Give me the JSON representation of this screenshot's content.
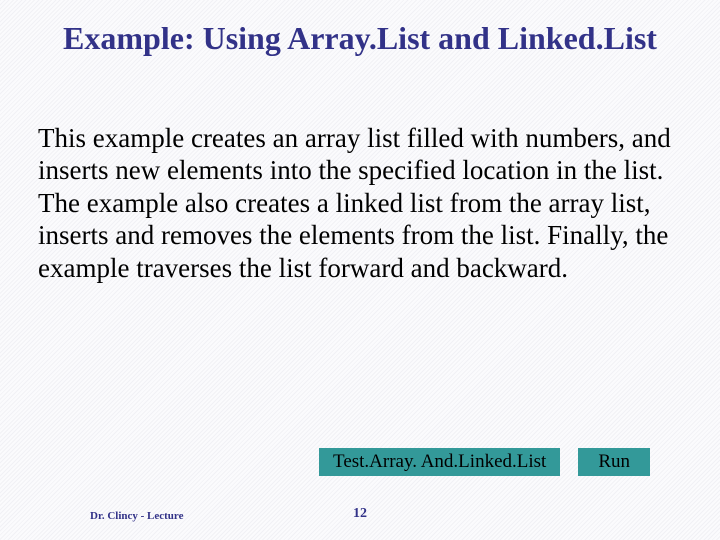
{
  "title": "Example: Using Array.List and Linked.List",
  "body": "This example creates an array list filled with numbers, and inserts new elements into the specified location in the list. The example also creates a linked list from the array list, inserts and removes the elements from the list. Finally, the example traverses the list forward and backward.",
  "buttons": {
    "test_label": "Test.Array. And.Linked.List",
    "run_label": "Run"
  },
  "footer": {
    "left": "Dr. Clincy - Lecture",
    "page": "12"
  }
}
